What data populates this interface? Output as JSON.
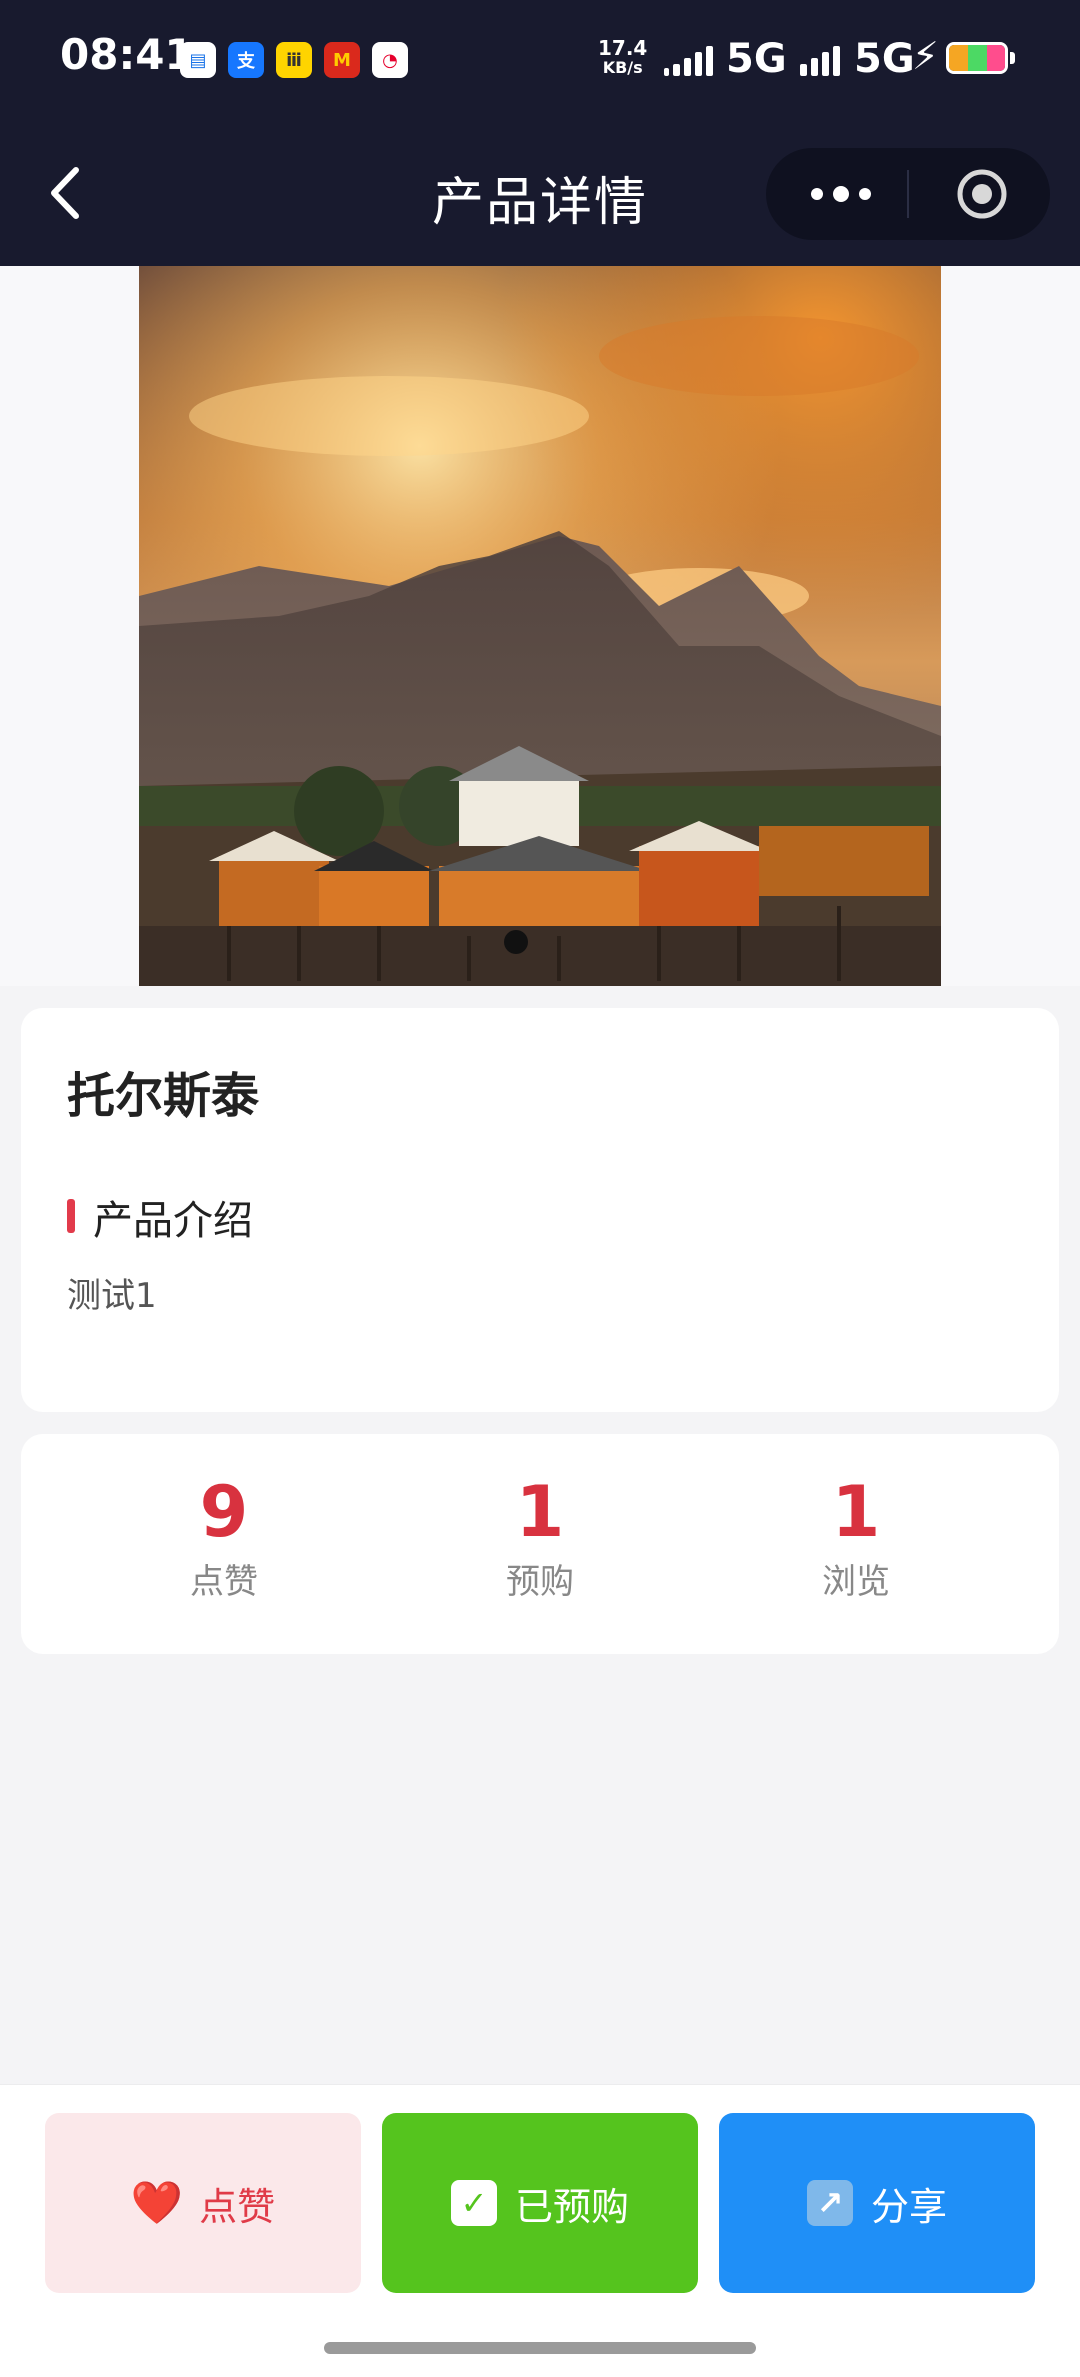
{
  "status_bar": {
    "time": "08:41",
    "net_speed_value": "17.4",
    "net_speed_unit": "KB/s",
    "network_1": "5G",
    "network_2": "5G",
    "app_icons": [
      {
        "name": "message-app-icon",
        "color": "#ffffff",
        "text": ""
      },
      {
        "name": "alipay-app-icon",
        "color": "#1677ff",
        "text": "支"
      },
      {
        "name": "yellow-app-icon",
        "color": "#ffd400",
        "text": "ⅲ"
      },
      {
        "name": "mcdonalds-app-icon",
        "color": "#da291c",
        "text": "M"
      },
      {
        "name": "red-app-icon",
        "color": "#e6002d",
        "text": "◔"
      }
    ]
  },
  "nav": {
    "title": "产品详情"
  },
  "product": {
    "name": "托尔斯泰",
    "section_title": "产品介绍",
    "intro": "测试1"
  },
  "stats": [
    {
      "value": "9",
      "label": "点赞"
    },
    {
      "value": "1",
      "label": "预购"
    },
    {
      "value": "1",
      "label": "浏览"
    }
  ],
  "actions": {
    "like": {
      "icon": "❤️",
      "label": "点赞"
    },
    "preorder": {
      "icon": "✓",
      "label": "已预购"
    },
    "share": {
      "icon": "↗",
      "label": "分享"
    }
  },
  "colors": {
    "accent_red": "#d8323f",
    "like_bg": "#fbe8ea",
    "preorder_bg": "#55c41e",
    "share_bg": "#1f8ff7",
    "nav_bg": "#181a2e"
  }
}
